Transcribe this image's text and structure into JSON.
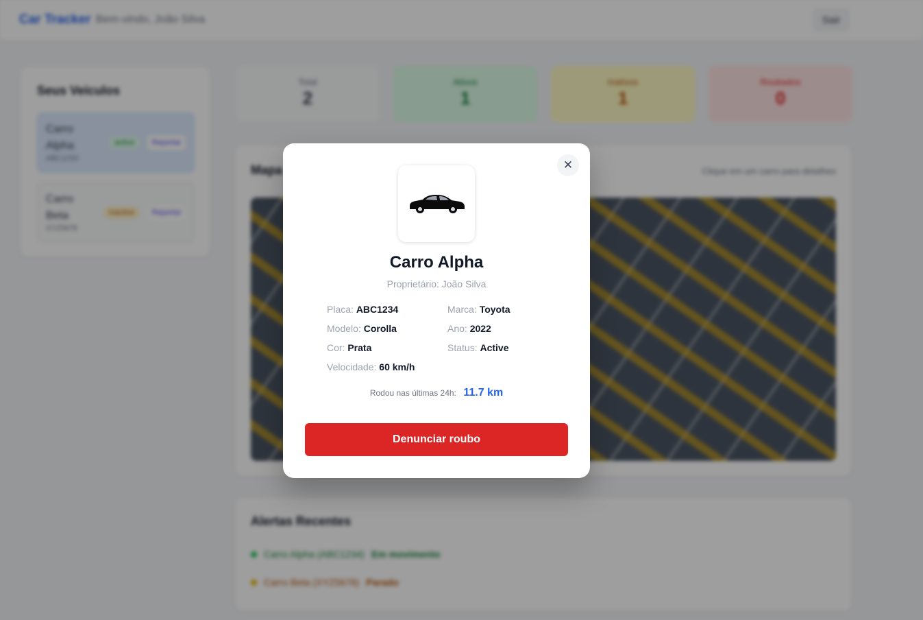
{
  "header": {
    "brand": "Car Tracker",
    "welcome": "Bem-vindo, João Silva",
    "logout_label": "Sair"
  },
  "sidebar": {
    "title": "Seus Veículos",
    "vehicles": [
      {
        "name": "Carro Alpha",
        "plate": "ABC1234",
        "status": "active",
        "action": "Reportar",
        "status_color": "#15803d"
      },
      {
        "name": "Carro Beta",
        "plate": "XYZ5678",
        "status": "inactive",
        "action": "Reportar",
        "status_color": "#b45309"
      }
    ]
  },
  "stats": [
    {
      "label": "Total",
      "value": "2",
      "bg": "#f9fafb",
      "color": "#374151"
    },
    {
      "label": "Ativos",
      "value": "1",
      "bg": "#dcfce7",
      "color": "#15803d"
    },
    {
      "label": "Inativos",
      "value": "1",
      "bg": "#fef9c3",
      "color": "#b45309"
    },
    {
      "label": "Roubados",
      "value": "0",
      "bg": "#fee2e2",
      "color": "#dc2626"
    }
  ],
  "map": {
    "title": "Mapa",
    "hint": "Clique em um carro para detalhes"
  },
  "alerts": {
    "title": "Alertas Recentes",
    "items": [
      {
        "text": "Carro Alpha (ABC1234)",
        "status": "Em movimento",
        "color": "#22c55e"
      },
      {
        "text": "Carro Beta (XYZ5678)",
        "status": "Parado",
        "color": "#eab308"
      }
    ]
  },
  "modal": {
    "close_icon": "close-icon",
    "car_icon": "car-icon",
    "title": "Carro Alpha",
    "owner": "Proprietário: João Silva",
    "fields": {
      "placa": {
        "label": "Placa:",
        "value": "ABC1234"
      },
      "marca": {
        "label": "Marca:",
        "value": "Toyota"
      },
      "modelo": {
        "label": "Modelo:",
        "value": "Corolla"
      },
      "ano": {
        "label": "Ano:",
        "value": "2022"
      },
      "cor": {
        "label": "Cor:",
        "value": "Prata"
      },
      "status": {
        "label": "Status:",
        "value": "Active"
      },
      "velocidade": {
        "label": "Velocidade:",
        "value": "60 km/h"
      }
    },
    "distance_label": "Rodou nas últimas 24h:",
    "distance_value": "11.7 km",
    "report_button": "Denunciar roubo",
    "accent_color": "#2563eb",
    "danger_color": "#dc2626"
  }
}
